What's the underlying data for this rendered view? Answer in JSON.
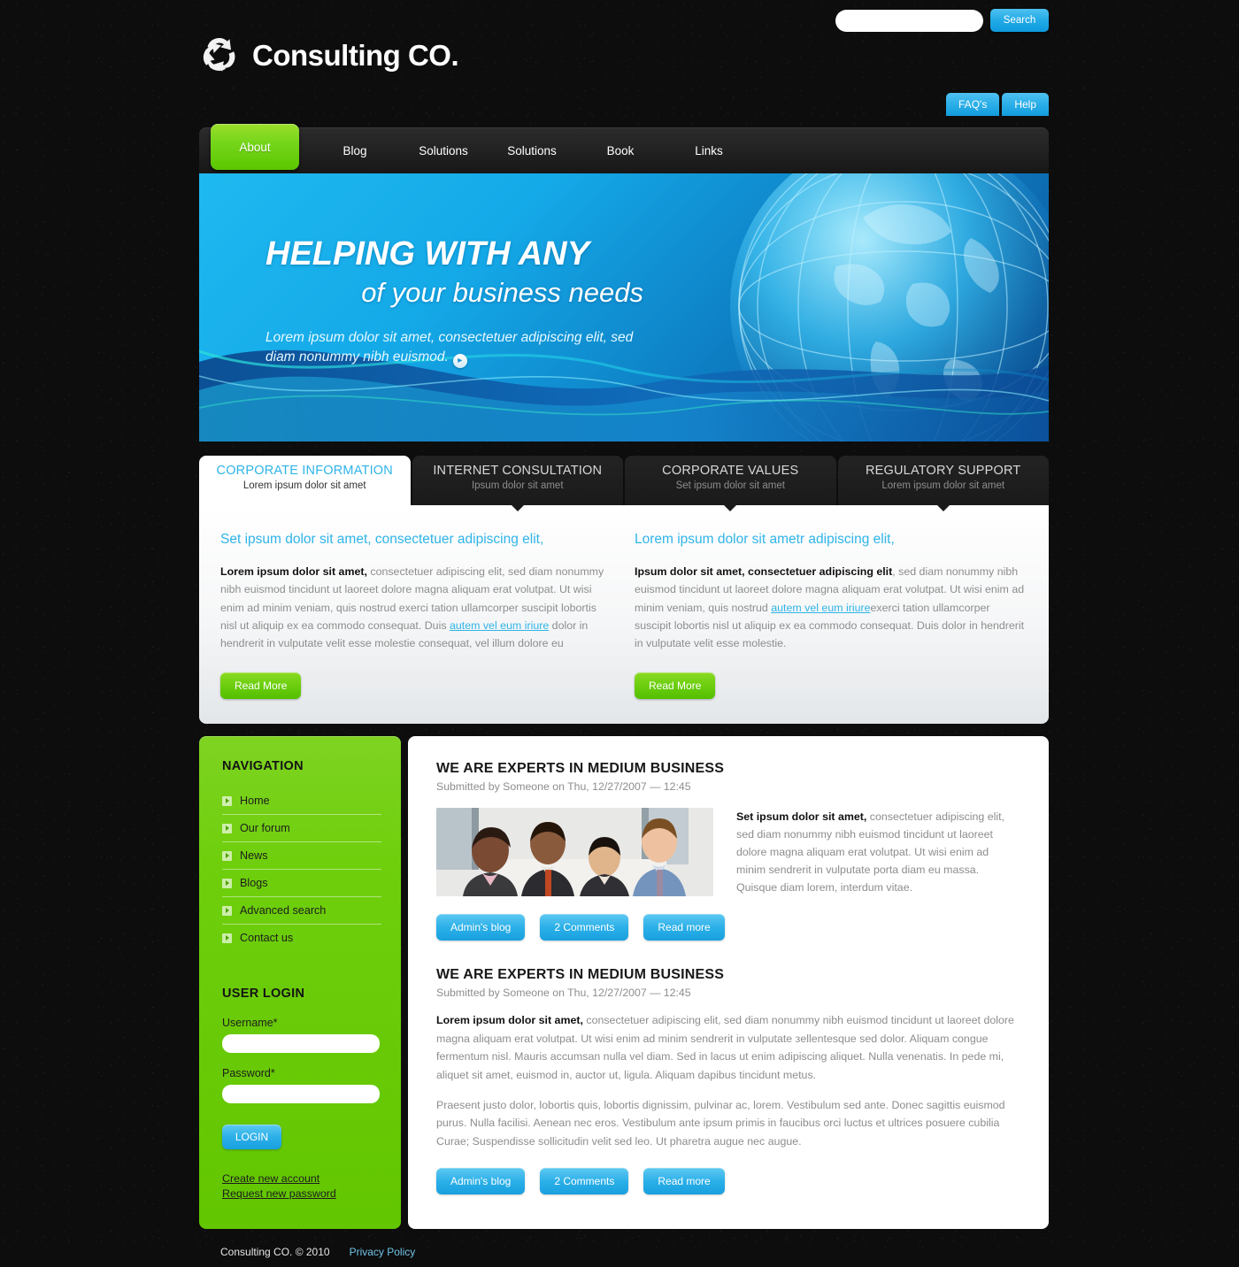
{
  "brand": {
    "name": "Consulting CO.",
    "logo_icon": "recycle-swirl-icon",
    "accent_green": "#6ecf10",
    "accent_blue": "#2cb0e8",
    "dark_bg": "#0d0d0d"
  },
  "search": {
    "value": "",
    "placeholder": "",
    "button_label": "Search",
    "icon": "search-icon"
  },
  "help_tabs": [
    {
      "label": "FAQ's"
    },
    {
      "label": "Help"
    }
  ],
  "nav": {
    "items": [
      {
        "label": "About",
        "active": true
      },
      {
        "label": "Blog",
        "active": false
      },
      {
        "label": "Solutions",
        "active": false
      },
      {
        "label": "Solutions",
        "active": false
      },
      {
        "label": "Book",
        "active": false
      },
      {
        "label": "Links",
        "active": false
      }
    ]
  },
  "hero": {
    "heading_line1": "HELPING WITH ANY",
    "heading_line2": "of your business needs",
    "subtext": "Lorem ipsum dolor sit amet, consectetuer adipiscing elit, sed diam nonummy nibh euismod.",
    "arrow_icon": "chevron-right-icon",
    "arrow_glyph": "▸"
  },
  "tabs": [
    {
      "title": "CORPORATE INFORMATION",
      "subtitle": "Lorem ipsum dolor sit amet",
      "active": true
    },
    {
      "title": "INTERNET CONSULTATION",
      "subtitle": "Ipsum dolor sit amet",
      "active": false
    },
    {
      "title": "CORPORATE VALUES",
      "subtitle": "Set ipsum dolor sit amet",
      "active": false
    },
    {
      "title": "REGULATORY SUPPORT",
      "subtitle": "Lorem ipsum dolor sit amet",
      "active": false
    }
  ],
  "tab_body": {
    "left": {
      "title": "Set ipsum dolor sit amet, consectetuer adipiscing elit,",
      "lead": "Lorem ipsum dolor sit amet,",
      "text_before_link": " consectetuer adipiscing elit, sed diam nonummy nibh euismod tincidunt ut laoreet dolore magna aliquam erat volutpat. Ut wisi enim ad minim veniam, quis nostrud exerci tation ullamcorper suscipit lobortis nisl ut aliquip ex ea commodo consequat. Duis ",
      "link": "autem vel eum iriure",
      "text_after_link": " dolor in hendrerit in vulputate velit esse molestie consequat, vel illum dolore eu",
      "button_label": "Read More"
    },
    "right": {
      "title": "Lorem ipsum dolor sit ametr adipiscing elit,",
      "lead": "Ipsum dolor sit amet, consectetuer adipiscing elit",
      "text_before_link": ", sed diam nonummy nibh euismod tincidunt ut laoreet dolore magna aliquam erat volutpat. Ut wisi enim ad minim veniam, quis nostrud ",
      "link": "autem vel eum iriure",
      "text_after_link": "exerci tation ullamcorper suscipit lobortis nisl ut aliquip ex ea commodo consequat. Duis  dolor in hendrerit in vulputate velit esse molestie.",
      "button_label": "Read More"
    }
  },
  "sidebar": {
    "nav_title": "NAVIGATION",
    "nav_items": [
      {
        "label": "Home"
      },
      {
        "label": "Our forum"
      },
      {
        "label": "News"
      },
      {
        "label": "Blogs"
      },
      {
        "label": "Advanced search"
      },
      {
        "label": "Contact us"
      }
    ],
    "login_title": "USER LOGIN",
    "username_label": "Username*",
    "username_value": "",
    "password_label": "Password*",
    "password_value": "",
    "login_button": "LOGIN",
    "links": [
      {
        "label": "Create new account"
      },
      {
        "label": "Request new password"
      }
    ]
  },
  "posts": [
    {
      "title": "WE ARE EXPERTS IN MEDIUM BUSINESS",
      "meta": "Submitted by Someone on Thu, 12/27/2007 — 12:45",
      "has_photo": true,
      "photo_alt": "four business people team photo",
      "excerpt_lead": "Set ipsum dolor sit amet,",
      "excerpt_rest": " consectetuer adipiscing elit, sed diam nonummy nibh euismod tincidunt ut laoreet dolore magna aliquam erat volutpat. Ut wisi enim ad minim sendrerit in vulputate porta diam eu massa. Quisque diam lorem, interdum vitae.",
      "buttons": [
        {
          "label": "Admin's blog"
        },
        {
          "label": "2 Comments"
        },
        {
          "label": "Read more"
        }
      ]
    },
    {
      "title": "WE ARE EXPERTS IN MEDIUM BUSINESS",
      "meta": "Submitted by Someone on Thu, 12/27/2007 — 12:45",
      "has_photo": false,
      "body_lead": "Lorem ipsum dolor sit amet,",
      "body_rest": " consectetuer adipiscing elit, sed diam nonummy nibh euismod tincidunt ut laoreet dolore magna aliquam erat volutpat. Ut wisi enim ad minim sendrerit in vulputate зellentesque sed dolor. Aliquam congue fermentum nisl. Mauris accumsan nulla vel diam. Sed in lacus ut enim adipiscing aliquet. Nulla venenatis. In pede mi, aliquet sit amet, euismod in, auctor ut, ligula. Aliquam dapibus tincidunt metus.",
      "body_para2": "Praesent justo dolor, lobortis quis, lobortis dignissim, pulvinar ac, lorem. Vestibulum sed ante. Donec sagittis euismod purus. Nulla facilisi. Aenean nec eros. Vestibulum ante ipsum primis in faucibus orci luctus et ultrices posuere cubilia Curae; Suspendisse sollicitudin velit sed leo. Ut pharetra augue nec augue.",
      "buttons": [
        {
          "label": "Admin's blog"
        },
        {
          "label": "2 Comments"
        },
        {
          "label": "Read more"
        }
      ]
    }
  ],
  "footer": {
    "copyright": "Consulting CO. © 2010",
    "privacy_label": "Privacy Policy"
  }
}
